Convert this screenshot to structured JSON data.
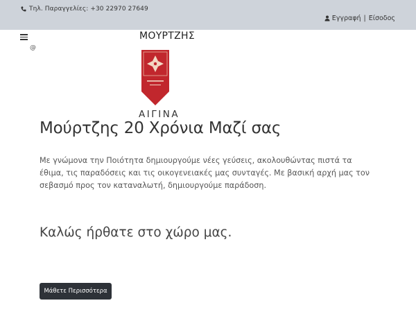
{
  "topbar": {
    "phone_icon": "phone-icon",
    "phone_text": "Τηλ. Παραγγελίες: +30 22970 27649",
    "user_icon": "user-icon",
    "register_label": "Εγγραφή",
    "separator": "|",
    "login_label": "Είσοδος"
  },
  "header": {
    "menu_icon": "hamburger-menu-icon",
    "brand_name": "ΜΟΥΡΤΖΗΣ",
    "small_icon_glyph": "@",
    "logo_caption": "ΑΙΓΙΝΑ"
  },
  "main": {
    "title": "Μούρτζης 20 Χρόνια Μαζί σας",
    "intro": "Με γνώμονα την Ποιότητα δημιουργούμε νέες γεύσεις, ακολουθώντας πιστά τα έθιμα, τις παραδόσεις και τις οικογενειακές μας συνταγές. Με βασική αρχή μας τον σεβασμό προς τον καταναλωτή, δημιουργούμε παράδοση.",
    "welcome": "Καλώς ήρθατε στο χώρο μας.",
    "cta_label": "Μάθετε Περισσότερα"
  },
  "colors": {
    "topbar_bg": "#ced3da",
    "logo_red": "#c1272d",
    "button_bg": "#2e3238"
  }
}
